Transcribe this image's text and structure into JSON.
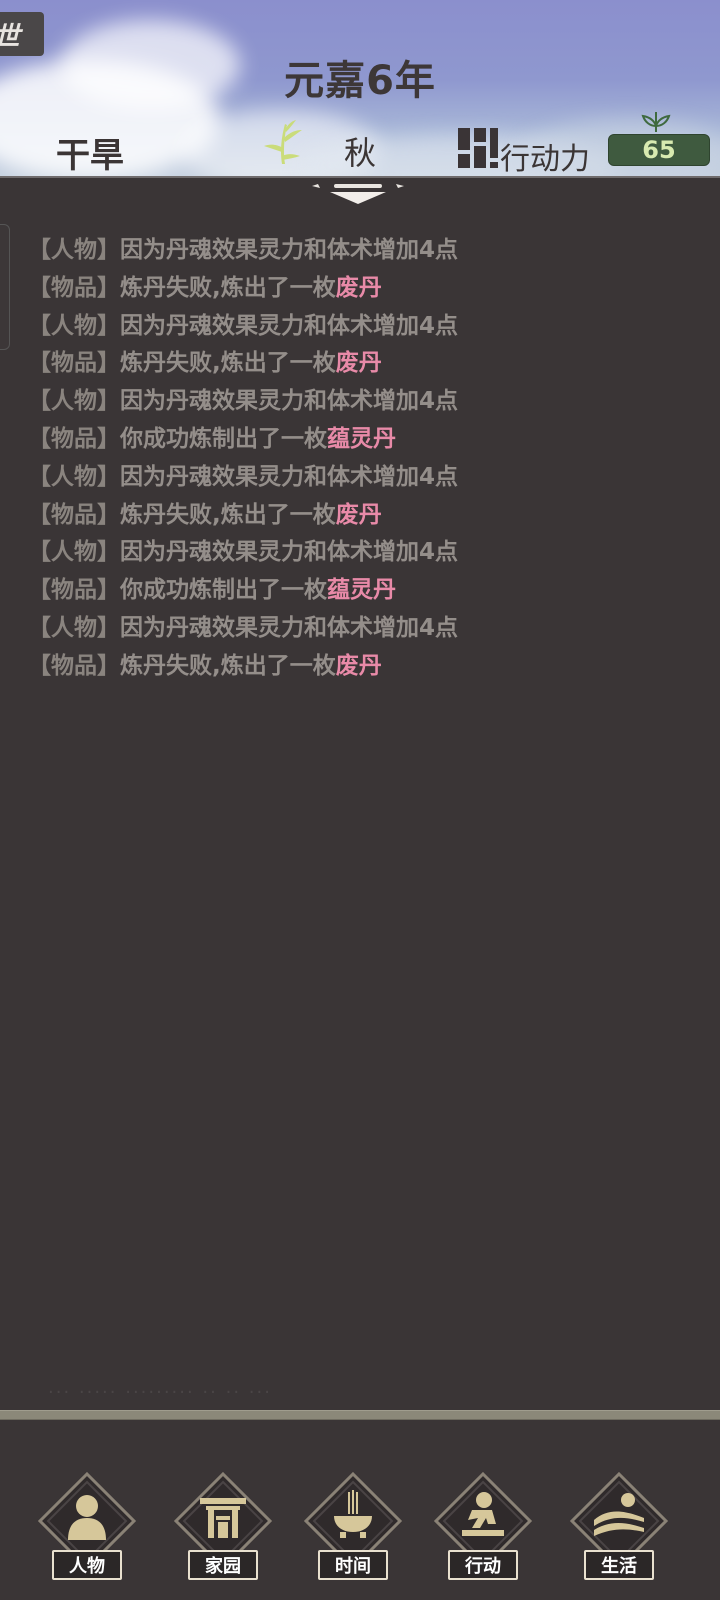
{
  "header": {
    "back_tab_glyph": "世",
    "title": "元嘉6年",
    "weather": "干旱",
    "season": "秋",
    "action_points_label": "行动力",
    "action_points_value": "65"
  },
  "log": {
    "entries": [
      {
        "tag": "【人物】",
        "text": "因为丹魂效果灵力和体术增加4点",
        "item": ""
      },
      {
        "tag": "【物品】",
        "text": "炼丹失败,炼出了一枚",
        "item": "废丹"
      },
      {
        "tag": "【人物】",
        "text": "因为丹魂效果灵力和体术增加4点",
        "item": ""
      },
      {
        "tag": "【物品】",
        "text": "炼丹失败,炼出了一枚",
        "item": "废丹"
      },
      {
        "tag": "【人物】",
        "text": "因为丹魂效果灵力和体术增加4点",
        "item": ""
      },
      {
        "tag": "【物品】",
        "text": "你成功炼制出了一枚",
        "item": "蕴灵丹"
      },
      {
        "tag": "【人物】",
        "text": "因为丹魂效果灵力和体术增加4点",
        "item": ""
      },
      {
        "tag": "【物品】",
        "text": "炼丹失败,炼出了一枚",
        "item": "废丹"
      },
      {
        "tag": "【人物】",
        "text": "因为丹魂效果灵力和体术增加4点",
        "item": ""
      },
      {
        "tag": "【物品】",
        "text": "你成功炼制出了一枚",
        "item": "蕴灵丹"
      },
      {
        "tag": "【人物】",
        "text": "因为丹魂效果灵力和体术增加4点",
        "item": ""
      },
      {
        "tag": "【物品】",
        "text": "炼丹失败,炼出了一枚",
        "item": "废丹"
      }
    ]
  },
  "nav": {
    "items": [
      {
        "label": "人物",
        "icon": "person-icon"
      },
      {
        "label": "家园",
        "icon": "gate-icon"
      },
      {
        "label": "时间",
        "icon": "incense-icon"
      },
      {
        "label": "行动",
        "icon": "action-icon"
      },
      {
        "label": "生活",
        "icon": "landscape-icon"
      }
    ]
  },
  "colors": {
    "background": "#3a3536",
    "log_text": "#948e8a",
    "item_highlight": "#e88aa8",
    "action_points_badge": "#3f5a3f",
    "nav_icon": "#d6c79a"
  }
}
